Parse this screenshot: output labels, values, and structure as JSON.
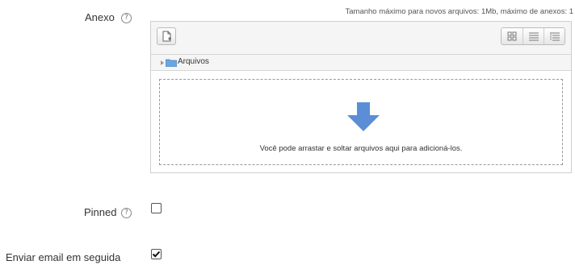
{
  "anexo": {
    "label": "Anexo",
    "help_icon": "help-icon",
    "max_info": "Tamanho máximo para novos arquivos: 1Mb, máximo de anexos: 1",
    "folder_label": "Arquivos",
    "drop_text": "Você pode arrastar e soltar arquivos aqui para adicioná-los.",
    "view_icons": [
      "icons-view-icon",
      "list-view-icon",
      "tree-view-icon"
    ]
  },
  "pinned": {
    "label": "Pinned",
    "checked": false
  },
  "email": {
    "label": "Enviar email em seguida",
    "checked": true
  },
  "colors": {
    "arrow": "#5b8ed6",
    "folder": "#6aa6e0"
  }
}
